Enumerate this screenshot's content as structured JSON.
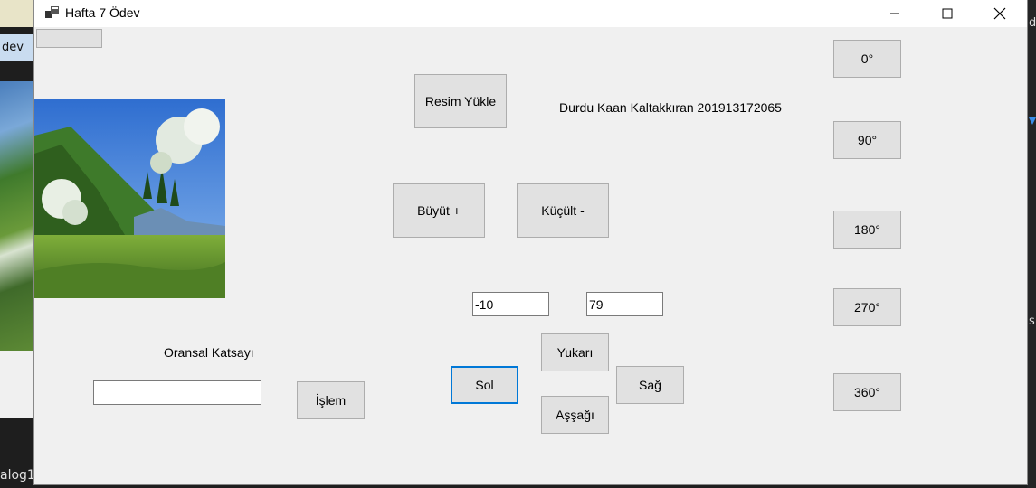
{
  "background": {
    "left_tab_text": "dev",
    "left_bottom_text": "alog1",
    "right_top_text": "d",
    "right_mid_text": "s"
  },
  "window": {
    "title": "Hafta 7 Ödev",
    "icon": "app-window-icon",
    "controls": [
      "minimize-icon",
      "maximize-icon",
      "close-icon"
    ]
  },
  "form": {
    "student_label": "Durdu Kaan Kaltakkıran 201913172065",
    "load_image_button": "Resim Yükle",
    "zoom_in_button": "Büyüt +",
    "zoom_out_button": "Küçült -",
    "x_field_value": "-10",
    "y_field_value": "79",
    "up_button": "Yukarı",
    "left_button": "Sol",
    "right_button": "Sağ",
    "down_button": "Aşşağı",
    "ratio_label": "Oransal Katsayı",
    "ratio_field_value": "",
    "process_button": "İşlem",
    "rotate_buttons": [
      "0°",
      "90°",
      "180°",
      "270°",
      "360°"
    ],
    "top_left_button": ""
  },
  "colors": {
    "window_bg": "#f0f0f0",
    "button_bg": "#e1e1e1",
    "focus_border": "#0078d7"
  }
}
